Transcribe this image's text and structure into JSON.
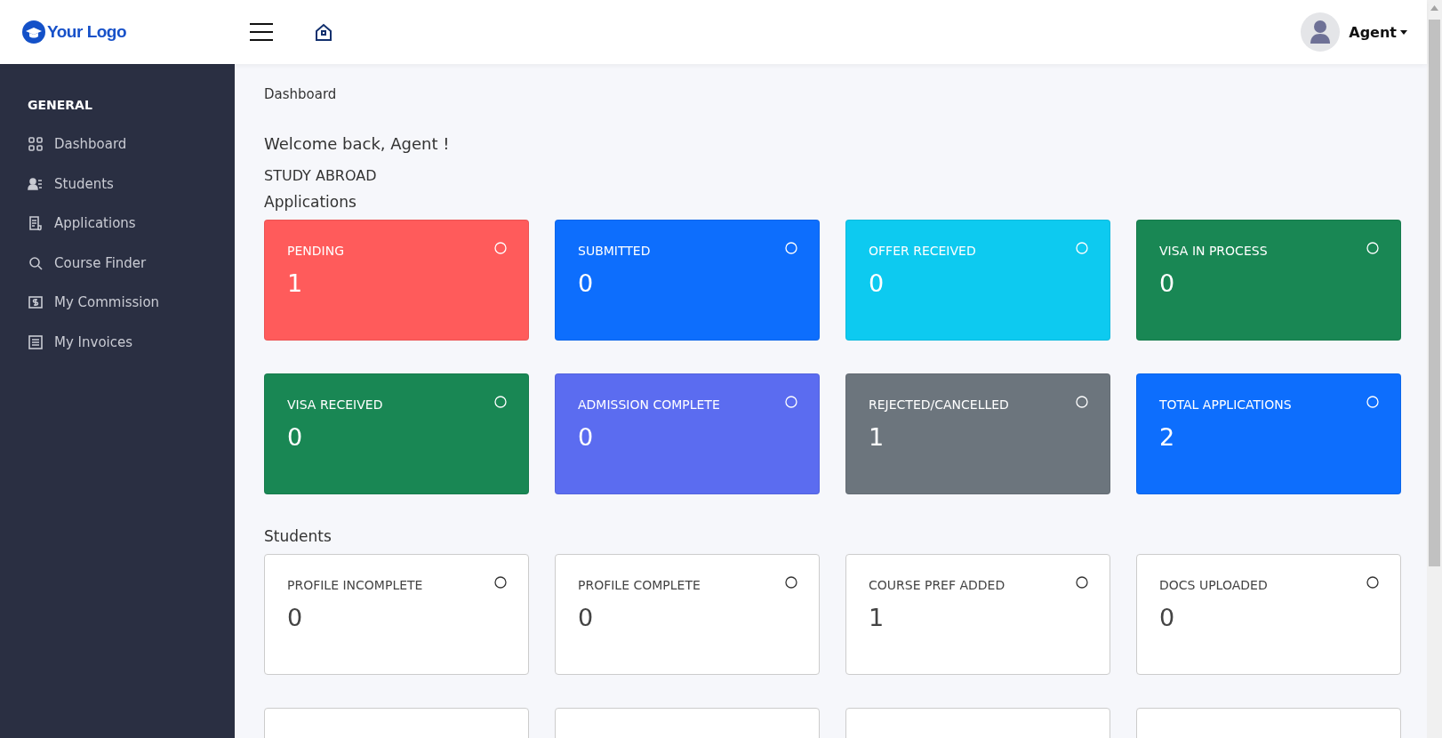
{
  "header": {
    "logo": "Your Logo",
    "user": "Agent"
  },
  "sidebar": {
    "heading": "GENERAL",
    "items": [
      {
        "label": "Dashboard"
      },
      {
        "label": "Students"
      },
      {
        "label": "Applications"
      },
      {
        "label": "Course Finder"
      },
      {
        "label": "My Commission"
      },
      {
        "label": "My Invoices"
      }
    ]
  },
  "breadcrumb": "Dashboard",
  "welcome": "Welcome back, Agent !",
  "section_label": "STUDY ABROAD",
  "sections": [
    {
      "title": "Applications",
      "kind": "filled",
      "cards": [
        {
          "label": "PENDING",
          "value": "1",
          "color": "#ff5b5b"
        },
        {
          "label": "SUBMITTED",
          "value": "0",
          "color": "#0d6efd"
        },
        {
          "label": "OFFER RECEIVED",
          "value": "0",
          "color": "#0dcaf0"
        },
        {
          "label": "VISA IN PROCESS",
          "value": "0",
          "color": "#198754"
        },
        {
          "label": "VISA RECEIVED",
          "value": "0",
          "color": "#198754"
        },
        {
          "label": "ADMISSION COMPLETE",
          "value": "0",
          "color": "#5b6cf0"
        },
        {
          "label": "REJECTED/CANCELLED",
          "value": "1",
          "color": "#6c757d"
        },
        {
          "label": "TOTAL APPLICATIONS",
          "value": "2",
          "color": "#0d6efd"
        }
      ]
    },
    {
      "title": "Students",
      "kind": "outline",
      "cards": [
        {
          "label": "PROFILE INCOMPLETE",
          "value": "0"
        },
        {
          "label": "PROFILE COMPLETE",
          "value": "0"
        },
        {
          "label": "COURSE PREF ADDED",
          "value": "1"
        },
        {
          "label": "DOCS UPLOADED",
          "value": "0"
        },
        {
          "kind": "cut"
        },
        {
          "kind": "cut"
        },
        {
          "kind": "cut"
        },
        {
          "kind": "cut"
        }
      ]
    }
  ]
}
